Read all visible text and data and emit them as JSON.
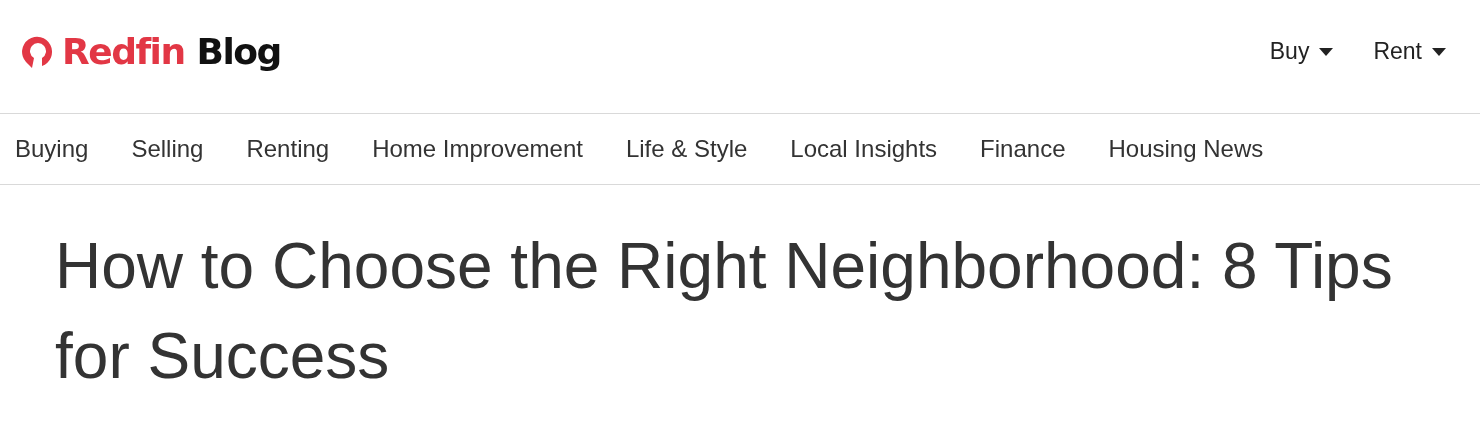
{
  "logo": {
    "brand": "Redfin",
    "section": "Blog"
  },
  "top_menu": [
    {
      "label": "Buy"
    },
    {
      "label": "Rent"
    }
  ],
  "categories": [
    "Buying",
    "Selling",
    "Renting",
    "Home Improvement",
    "Life & Style",
    "Local Insights",
    "Finance",
    "Housing News"
  ],
  "article": {
    "title": "How to Choose the Right Neighborhood: 8 Tips for Success"
  }
}
